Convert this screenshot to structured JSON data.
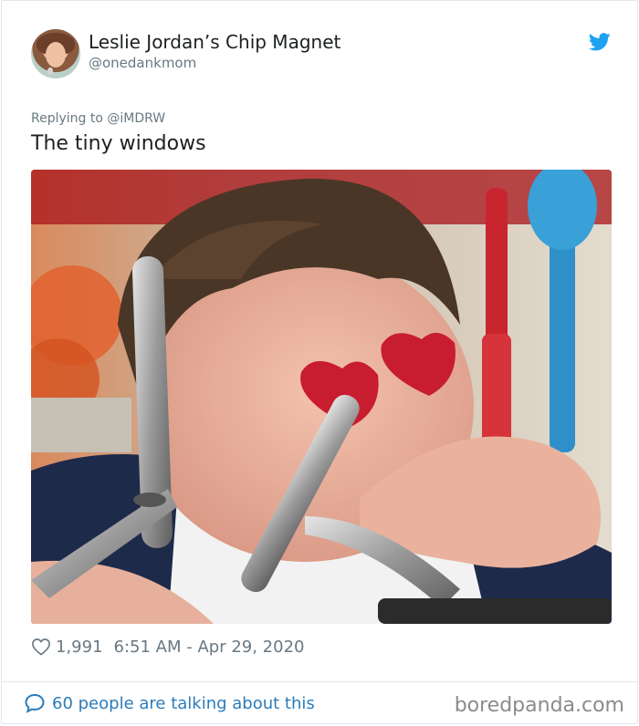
{
  "tweet": {
    "author": {
      "display_name": "Leslie Jordan’s Chip Magnet",
      "handle": "@onedankmom"
    },
    "reply_to": "Replying to @iMDRW",
    "text": "The tiny windows",
    "likes": "1,991",
    "timestamp": "6:51 AM - Apr 29, 2020",
    "conversation_link": "60 people are talking about this"
  },
  "watermark": "boredpanda.com",
  "icons": {
    "brand": "twitter-bird-icon",
    "like": "heart-icon",
    "conversation": "speech-bubble-icon"
  },
  "colors": {
    "brand_blue": "#1da1f2",
    "link_blue": "#2b7bb9",
    "muted_text": "#697882",
    "heart_overlay": "#c81d2f"
  }
}
